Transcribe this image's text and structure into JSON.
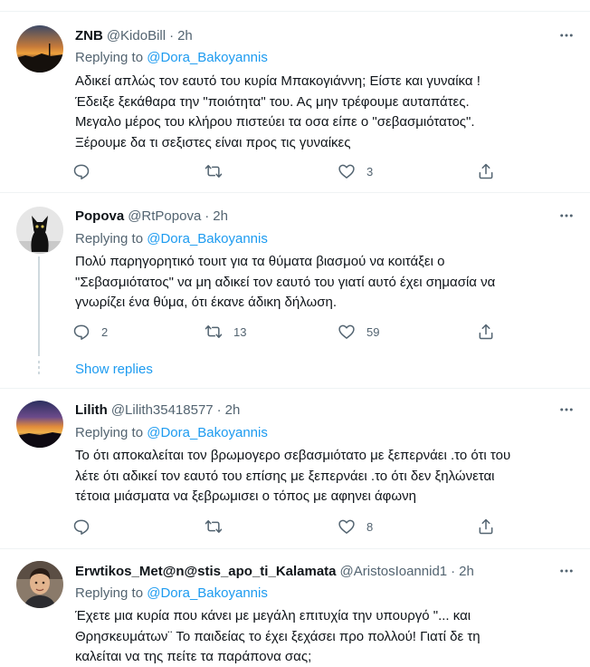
{
  "tweets": [
    {
      "display_name": "ZNB",
      "handle": "@KidoBill",
      "dot": "·",
      "time": "2h",
      "replying_prefix": "Replying to",
      "mention": "@Dora_Bakoyannis",
      "lines": [
        "Αδικεί απλώς τον εαυτό του κυρία Μπακογιάννη; Είστε και γυναίκα !",
        "Έδειξε ξεκάθαρα την \"ποιότητα\" του. Ας μην τρέφουμε αυταπάτες.",
        "Μεγαλο μέρος του κλήρου πιστεύει τα οσα είπε ο \"σεβασμιότατος\".",
        "Ξέρουμε δα τι σεξιστες είναι προς τις γυναίκες"
      ],
      "replies": "",
      "retweets": "",
      "likes": "3",
      "avatar": "sunset-orange"
    },
    {
      "display_name": "Popova",
      "handle": "@RtPopova",
      "dot": "·",
      "time": "2h",
      "replying_prefix": "Replying to",
      "mention": "@Dora_Bakoyannis",
      "lines": [
        "Πολύ παρηγορητικό τουιτ για τα θύματα βιασμού να κοιτάξει ο",
        "\"Σεβασμιότατος\" να μη αδικεί τον εαυτό του γιατί αυτό έχει σημασία να",
        "γνωρίζει ένα θύμα, ότι έκανε άδικη δήλωση."
      ],
      "replies": "2",
      "retweets": "13",
      "likes": "59",
      "avatar": "black-cat",
      "show_replies": "Show replies"
    },
    {
      "display_name": "Lilith",
      "handle": "@Lilith35418577",
      "dot": "·",
      "time": "2h",
      "replying_prefix": "Replying to",
      "mention": "@Dora_Bakoyannis",
      "lines": [
        "Το ότι αποκαλείται τον βρωμογερο σεβασμιότατο με ξεπερνάει .το ότι του",
        "λέτε ότι αδικεί τον εαυτό του επίσης με ξεπερνάει .το ότι δεν ξηλώνεται",
        "τέτοια μιάσματα να ξεβρωμισει ο τόπος με αφηνει άφωνη"
      ],
      "replies": "",
      "retweets": "",
      "likes": "8",
      "avatar": "sunset-purple"
    },
    {
      "display_name": "Erwtikos_Met@n@stis_apo_ti_Kalamata",
      "handle": "@AristosIoannid1",
      "dot": "·",
      "time": "2h",
      "replying_prefix": "Replying to",
      "mention": "@Dora_Bakoyannis",
      "lines": [
        "Έχετε μια κυρία που κάνει με μεγάλη επιτυχία την υπουργό \"... και",
        "Θρησκευμάτων¨ Το παιδείας το έχει ξεχάσει προ πολλού! Γιατί δε τη",
        "καλείται να της πείτε τα παράπονα σας;"
      ],
      "avatar": "man-portrait"
    }
  ],
  "colors": {
    "text": "#0f1419",
    "secondary": "#536471",
    "link": "#1d9bf0",
    "divider": "#eff3f4"
  },
  "icons": [
    "reply-icon",
    "retweet-icon",
    "like-icon",
    "share-icon",
    "more-icon"
  ]
}
